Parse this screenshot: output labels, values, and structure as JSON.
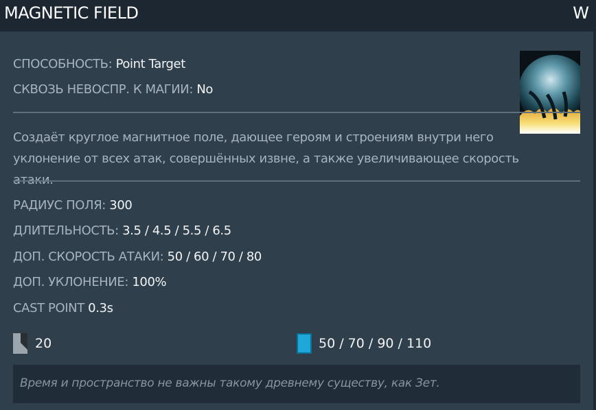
{
  "ability": {
    "name": "MAGNETIC FIELD",
    "hotkey": "W",
    "icon": "magnetic-field-ability-icon"
  },
  "properties": {
    "ability_label": "СПОСОБНОСТЬ:",
    "ability_value": "Point Target",
    "pierces_label": "СКВОЗЬ НЕВОСПР. К МАГИИ:",
    "pierces_value": "No"
  },
  "description": "Создаёт круглое магнитное поле, дающее героям и строениям внутри него уклонение от всех атак, совершённых извне, а также увеличивающее скорость атаки.",
  "stats": [
    {
      "label": "РАДИУС ПОЛЯ:",
      "value": "300"
    },
    {
      "label": "ДЛИТЕЛЬНОСТЬ:",
      "value": "3.5 / 4.5 / 5.5 / 6.5"
    },
    {
      "label": "ДОП. СКОРОСТЬ АТАКИ:",
      "value": "50 / 60 / 70 / 80"
    },
    {
      "label": "ДОП. УКЛОНЕНИЕ:",
      "value": "100%"
    },
    {
      "label": "CAST POINT",
      "value": "0.3s"
    }
  ],
  "costs": {
    "cooldown_icon": "cooldown-icon",
    "cooldown": "20",
    "mana_icon": "mana-icon",
    "mana": "50 / 70 / 90 / 110"
  },
  "lore": "Время и пространство не важны такому древнему существу, как Зет.",
  "colors": {
    "panel": "#2f3f4c",
    "header": "#1c2732",
    "label": "#a7b4bf",
    "value": "#f2f4f6",
    "mana": "#1ea7d8",
    "lore_bg": "#202c37"
  }
}
